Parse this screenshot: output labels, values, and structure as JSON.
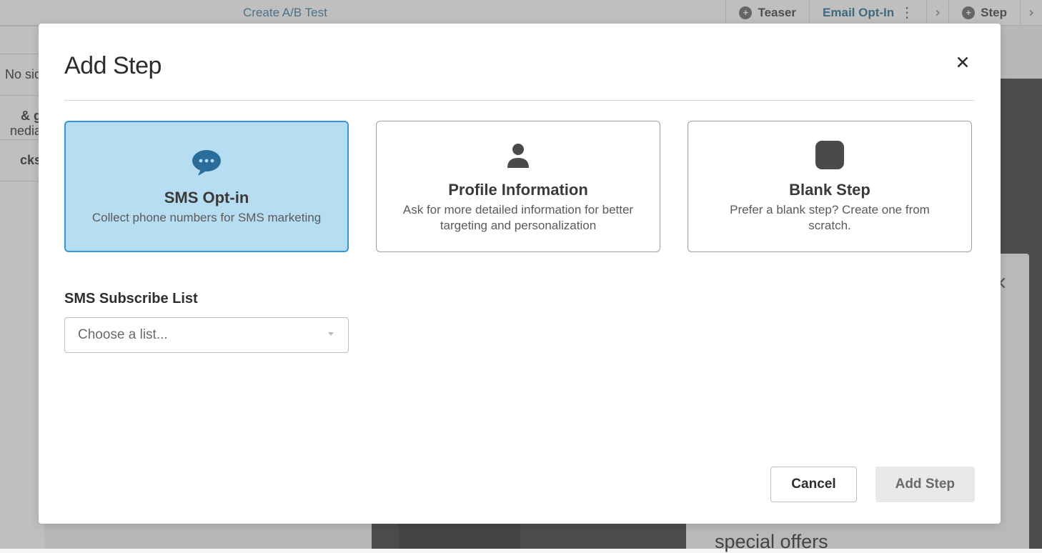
{
  "background": {
    "ab_test_link": "Create A/B Test",
    "steps": {
      "teaser": "Teaser",
      "email_optin": "Email Opt-In",
      "step": "Step"
    },
    "sidebar": {
      "item0": "No sid",
      "item1": "g &",
      "item2": "nedia",
      "item3": "cks"
    },
    "offers_text": "special offers"
  },
  "modal": {
    "title": "Add Step",
    "options": [
      {
        "title": "SMS Opt-in",
        "desc": "Collect phone numbers for SMS marketing"
      },
      {
        "title": "Profile Information",
        "desc": "Ask for more detailed information for better targeting and personalization"
      },
      {
        "title": "Blank Step",
        "desc": "Prefer a blank step? Create one from scratch."
      }
    ],
    "form": {
      "list_label": "SMS Subscribe List",
      "list_placeholder": "Choose a list..."
    },
    "buttons": {
      "cancel": "Cancel",
      "submit": "Add Step"
    }
  }
}
